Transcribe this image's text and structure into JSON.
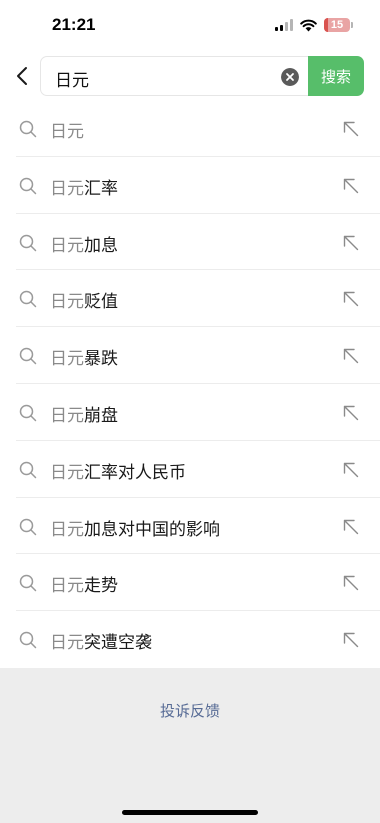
{
  "status_bar": {
    "time": "21:21",
    "battery_level": "15",
    "battery_color": "#d9534f",
    "icons": [
      "cellular-signal-icon",
      "wifi-icon",
      "battery-icon"
    ]
  },
  "search": {
    "query": "日元",
    "search_button_label": "搜索",
    "accent_color": "#57be6a",
    "icons": [
      "back-arrow-icon",
      "clear-icon"
    ]
  },
  "suggestions": [
    {
      "prefix": "日元",
      "suffix": ""
    },
    {
      "prefix": "日元",
      "suffix": "汇率"
    },
    {
      "prefix": "日元",
      "suffix": "加息"
    },
    {
      "prefix": "日元",
      "suffix": "贬值"
    },
    {
      "prefix": "日元",
      "suffix": "暴跌"
    },
    {
      "prefix": "日元",
      "suffix": "崩盘"
    },
    {
      "prefix": "日元",
      "suffix": "汇率对人民币"
    },
    {
      "prefix": "日元",
      "suffix": "加息对中国的影响"
    },
    {
      "prefix": "日元",
      "suffix": "走势"
    },
    {
      "prefix": "日元",
      "suffix": "突遭空袭"
    }
  ],
  "suggestion_icons": [
    "search-icon",
    "fill-query-arrow-icon"
  ],
  "footer": {
    "feedback_label": "投诉反馈",
    "link_color": "#576b95"
  }
}
